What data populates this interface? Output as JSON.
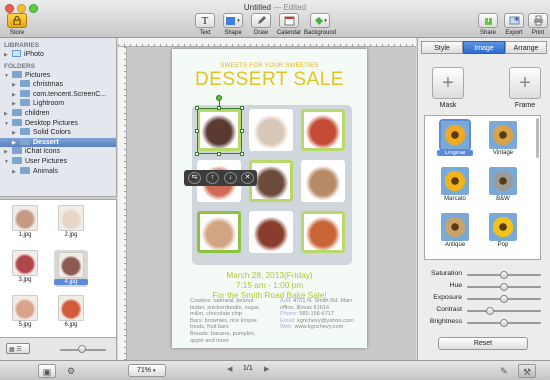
{
  "window": {
    "title": "Untitled",
    "edited": "— Edited"
  },
  "toolbar": {
    "store": "Store",
    "text": "Text",
    "shape": "Shape",
    "draw": "Draw",
    "calendar": "Calendar",
    "background": "Background",
    "share": "Share",
    "export": "Export",
    "print": "Print"
  },
  "sidebar": {
    "libraries_header": "LIBRARIES",
    "iphoto": "iPhoto",
    "folders_header": "FOLDERS",
    "items": [
      {
        "label": "Pictures",
        "indent": 0,
        "open": true
      },
      {
        "label": "christmas",
        "indent": 1,
        "open": false
      },
      {
        "label": "com.tencent.ScreenC...",
        "indent": 1,
        "open": false
      },
      {
        "label": "Lightroom",
        "indent": 1,
        "open": false
      },
      {
        "label": "children",
        "indent": 0,
        "open": false
      },
      {
        "label": "Desktop Pictures",
        "indent": 0,
        "open": true
      },
      {
        "label": "Solid Colors",
        "indent": 1,
        "open": false
      },
      {
        "label": "Dessert",
        "indent": 1,
        "open": false,
        "selected": true
      },
      {
        "label": "iChat Icons",
        "indent": 0,
        "open": false
      },
      {
        "label": "User Pictures",
        "indent": 0,
        "open": true
      },
      {
        "label": "Animals",
        "indent": 1,
        "open": false
      }
    ]
  },
  "thumbnails": [
    {
      "label": "1.jpg",
      "color": "#c79a86"
    },
    {
      "label": "2.jpg",
      "color": "#e8d6c8"
    },
    {
      "label": "3.jpg",
      "color": "#b2474b"
    },
    {
      "label": "4.jpg",
      "color": "#8c5a50",
      "selected": true
    },
    {
      "label": "5.jpg",
      "color": "#d8a38c"
    },
    {
      "label": "6.jpg",
      "color": "#d45a3c"
    }
  ],
  "poster": {
    "subhead": "SWEETS FOR YOUR SWEETIES",
    "headline": "DESSERT SALE",
    "date": "March 28, 2013(Friday)",
    "time": "7:15 am - 1:00 pm",
    "location": "For the Smith Road Bake Sale!",
    "menu": [
      "Cookies: oatmeal, peanut",
      "butter, snickerdoodle, sugar,",
      "m&m, chocolate chip",
      "Bars: brownies, rice krispie",
      "treats, fruit bars",
      "Breads: banana, pumpkin,",
      "apple and more"
    ],
    "contact": [
      {
        "k": "Add:",
        "v": "4701 N. Smith Rd. Main"
      },
      {
        "k": "",
        "v": "office, Illinois 61614"
      },
      {
        "k": "Phone:",
        "v": "585-156-6717"
      },
      {
        "k": "Email:",
        "v": "kgnchevy@yahoo.com"
      },
      {
        "k": "Web:",
        "v": "www.kgnchevy.com"
      }
    ],
    "cells": [
      "#5b3a34",
      "#d9c7b8",
      "#c44c35",
      "#d06a55",
      "#6e4a3c",
      "#b88a66",
      "#d1a583",
      "#8a3d2d",
      "#c96436"
    ]
  },
  "inspector": {
    "tabs": [
      "Style",
      "Image",
      "Arrange"
    ],
    "mask": "Mask",
    "frame": "Frame",
    "filters": [
      {
        "label": "Original",
        "selected": true
      },
      {
        "label": "Vintage"
      },
      {
        "label": "Marcato"
      },
      {
        "label": "B&W"
      },
      {
        "label": "Antique"
      },
      {
        "label": "Pop"
      }
    ],
    "sliders": [
      {
        "label": "Saturation",
        "value": 0.5
      },
      {
        "label": "Hue",
        "value": 0.5
      },
      {
        "label": "Exposure",
        "value": 0.5
      },
      {
        "label": "Contrast",
        "value": 0.3
      },
      {
        "label": "Brightness",
        "value": 0.5
      }
    ],
    "reset": "Reset"
  },
  "bottombar": {
    "zoom": "71%",
    "page": "1/1"
  },
  "colors": {
    "accent": "#2f6ccd",
    "headline": "#e3c321",
    "event": "#b4c335"
  }
}
